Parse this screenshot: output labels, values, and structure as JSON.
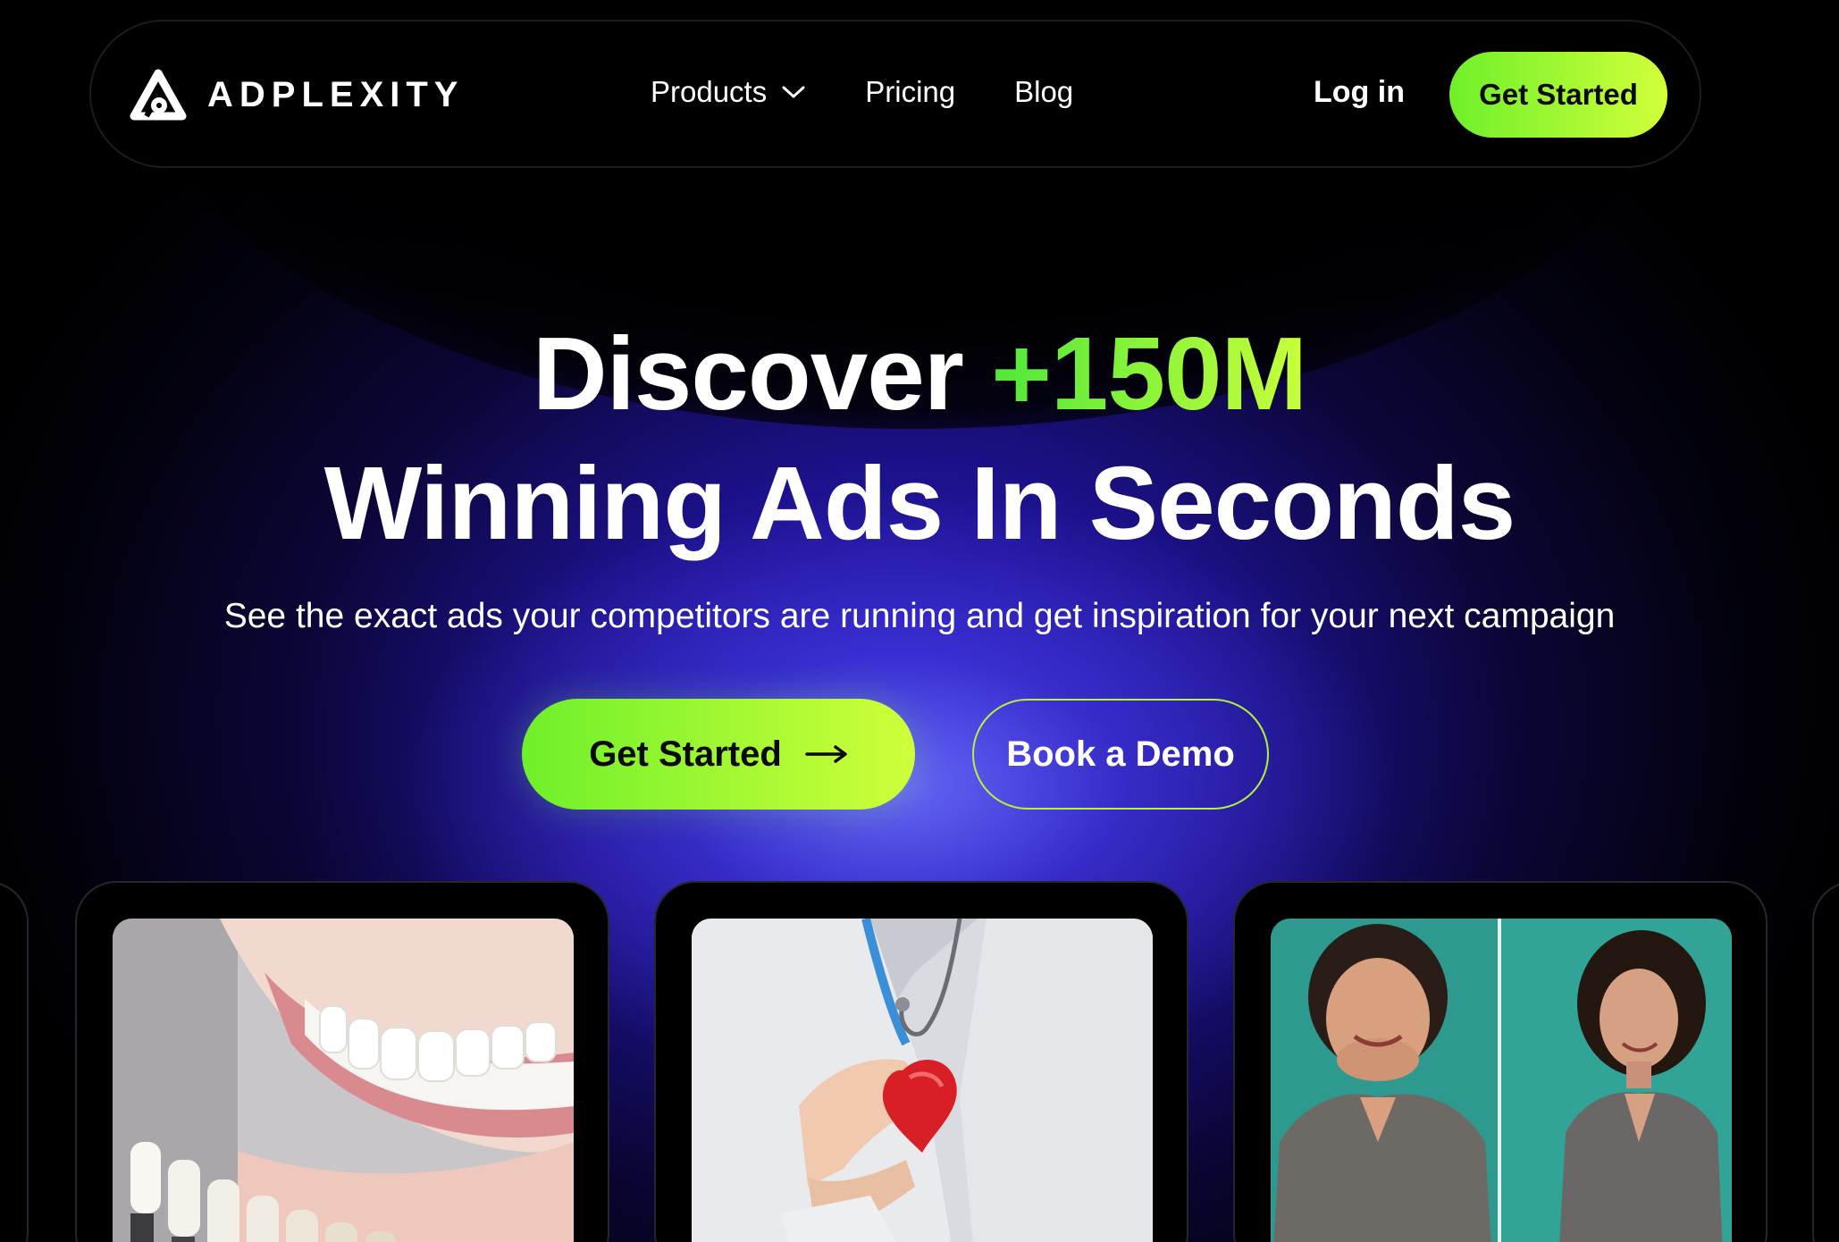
{
  "nav": {
    "brand": "ADPLEXITY",
    "links": [
      {
        "label": "Products",
        "has_dropdown": true
      },
      {
        "label": "Pricing"
      },
      {
        "label": "Blog"
      }
    ],
    "login_label": "Log in",
    "cta_label": "Get Started"
  },
  "hero": {
    "title_prefix": "Discover",
    "title_highlight": "+150M",
    "title_line2": "Winning Ads In Seconds",
    "subtitle": "See the exact ads your competitors are running and get inspiration for your next campaign",
    "primary_cta": "Get Started",
    "secondary_cta": "Book a Demo"
  },
  "ad_cards": [
    {
      "subject": "smiling-teeth-veneer-shade-guide"
    },
    {
      "subject": "doctor-holding-red-heart"
    },
    {
      "subject": "weight-loss-before-after"
    }
  ],
  "colors": {
    "accent_start": "#6ef02a",
    "accent_end": "#d1ff3a",
    "background": "#000000",
    "glow": "#3a22d8"
  }
}
